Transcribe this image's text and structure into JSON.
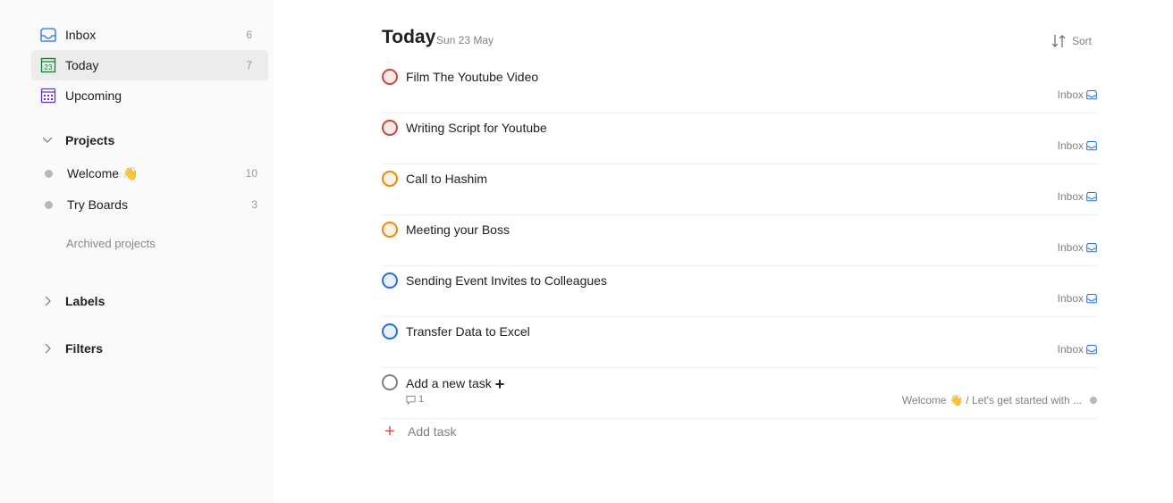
{
  "sidebar": {
    "nav": [
      {
        "label": "Inbox",
        "count": "6",
        "icon": "inbox-icon",
        "color": "#246fe0"
      },
      {
        "label": "Today",
        "count": "7",
        "icon": "calendar-today-icon",
        "icon_text": "23",
        "color": "#058527",
        "active": true
      },
      {
        "label": "Upcoming",
        "count": "",
        "icon": "calendar-upcoming-icon",
        "color": "#692fc2"
      }
    ],
    "projects_header": "Projects",
    "projects": [
      {
        "label": "Welcome",
        "emoji": "👋",
        "count": "10"
      },
      {
        "label": "Try Boards",
        "count": "3"
      }
    ],
    "archived_label": "Archived projects",
    "labels_header": "Labels",
    "filters_header": "Filters"
  },
  "main": {
    "title": "Today",
    "date": "Sun 23 May",
    "sort_label": "Sort",
    "tasks": [
      {
        "name": "Film The Youtube Video",
        "priority_color": "#d1453b",
        "fill": "#fbe9e8",
        "project": "Inbox"
      },
      {
        "name": "Writing Script for Youtube",
        "priority_color": "#d1453b",
        "fill": "#fbe9e8",
        "project": "Inbox"
      },
      {
        "name": "Call to Hashim",
        "priority_color": "#eb8909",
        "fill": "#fdf1e3",
        "project": "Inbox"
      },
      {
        "name": "Meeting your Boss",
        "priority_color": "#eb8909",
        "fill": "#fdf1e3",
        "project": "Inbox"
      },
      {
        "name": "Sending Event Invites to Colleagues",
        "priority_color": "#246fe0",
        "fill": "#e9f0fc",
        "project": "Inbox"
      },
      {
        "name": "Transfer Data to Excel",
        "priority_color": "#246fe0",
        "fill": "#e9f0fc",
        "project": "Inbox"
      },
      {
        "name": "Add a new task",
        "priority_color": "#808080",
        "fill": "#ffffff",
        "project": "Welcome 👋 / Let's get started with ...",
        "comments": "1",
        "has_plus": true
      }
    ],
    "add_task_label": "Add task"
  }
}
